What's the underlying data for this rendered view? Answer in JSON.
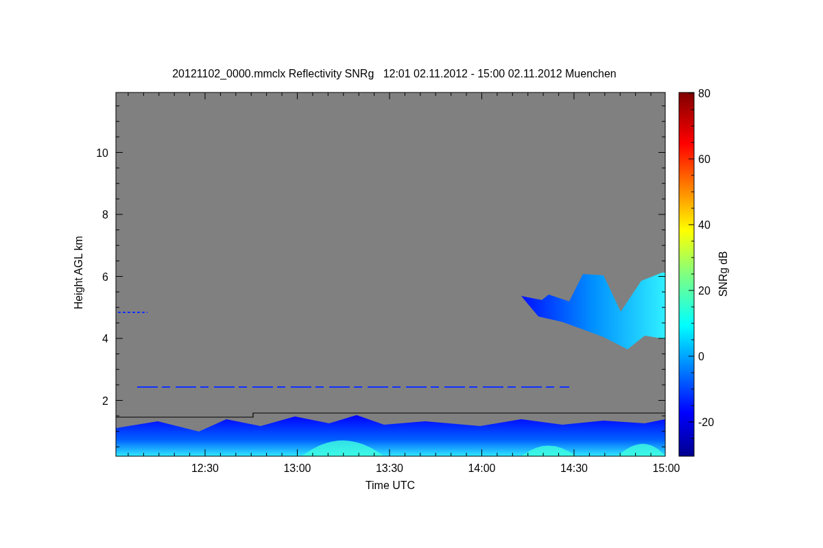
{
  "title": "20121102_0000.mmclx Reflectivity SNRg   12:01 02.11.2012 - 15:00 02.11.2012 Muenchen",
  "y_axis": {
    "label": "Height AGL km",
    "ticks": [
      "10",
      "8",
      "6",
      "4",
      "2"
    ]
  },
  "x_axis": {
    "label": "Time UTC",
    "ticks": [
      "12:30",
      "13:00",
      "13:30",
      "14:00",
      "14:30",
      "15:00"
    ]
  },
  "colorbar": {
    "label": "SNRg dB",
    "ticks": [
      "80",
      "60",
      "40",
      "20",
      "0",
      "-20"
    ]
  }
}
